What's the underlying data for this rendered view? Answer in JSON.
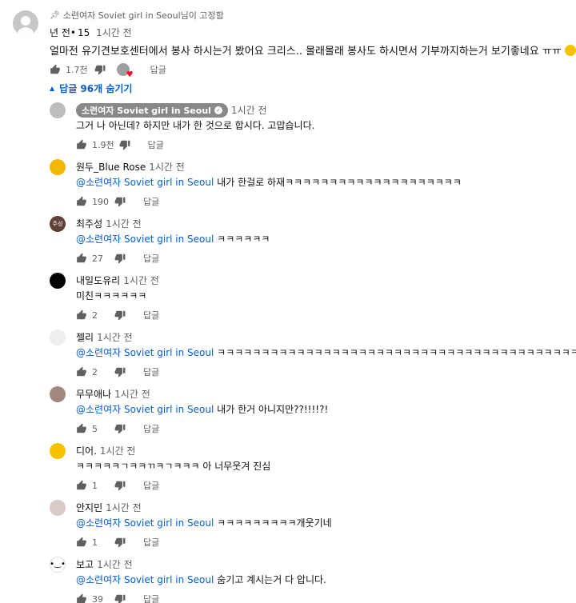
{
  "pinned": {
    "pinned_by": "소련여자 Soviet girl in Seoul님이 고정함",
    "author": "년 전•",
    "author_suffix": "15",
    "time": "1시간 전",
    "text": "얼마전 유기견보호센터에서 봉사 하시는거 봤어요 크리스.. 몰래몰래 봉사도 하시면서 기부까지하는거 보기좋네요 ㅠㅠ",
    "likes": "1.7천",
    "reply_label": "답글"
  },
  "replies_toggle": "답글 96개 숨기기",
  "replies": [
    {
      "author": "소련여자 Soviet girl in Seoul",
      "time": "1시간 전",
      "mention": "",
      "text": "그거 나 아닌데? 하지만 내가 한 것으로 합시다. 고맙습니다.",
      "likes": "1.9천",
      "reply_label": "답글",
      "avatar_color": "#bdbdbd"
    },
    {
      "author": "원두_Blue Rose",
      "time": "1시간 전",
      "mention": "@소련여자 Soviet girl in Seoul",
      "text": "내가 한걸로 하재ㅋㅋㅋㅋㅋㅋㅋㅋㅋㅋㅋㅋㅋㅋㅋㅋㅋㅋㅋㅋ",
      "likes": "190",
      "reply_label": "답글",
      "avatar_color": "#f2b705"
    },
    {
      "author": "최주성",
      "time": "1시간 전",
      "mention": "@소련여자 Soviet girl in Seoul",
      "text": "ㅋㅋㅋㅋㅋㅋ",
      "likes": "27",
      "reply_label": "답글",
      "avatar_color": "#5d4037",
      "avatar_text": "주성"
    },
    {
      "author": "내일도유리",
      "time": "1시간 전",
      "mention": "",
      "text": "미친ㅋㅋㅋㅋㅋㅋ",
      "likes": "2",
      "reply_label": "답글",
      "avatar_color": "#000000"
    },
    {
      "author": "젤리",
      "time": "1시간 전",
      "mention": "@소련여자 Soviet girl in Seoul",
      "text": "ㅋㅋㅋㅋㅋㅋㅋㅋㅋㅋㅋㅋㅋㅋㅋㅋㅋㅋㅋㅋㅋㅋㅋㅋㅋㅋㅋㅋㅋㅋㅋㅋㅋㅋㅋㅋㅋㅋㅋㅋㅋㅋ",
      "likes": "2",
      "reply_label": "답글",
      "avatar_color": "#eeeeee"
    },
    {
      "author": "무무애나",
      "time": "1시간 전",
      "mention": "@소련여자 Soviet girl in Seoul",
      "text": "내가 한거 아니지만??!!!!?!",
      "likes": "5",
      "reply_label": "답글",
      "avatar_color": "#a1887f"
    },
    {
      "author": "디어.",
      "time": "1시간 전",
      "mention": "",
      "text": "ㅋㅋㅋㅋㅋㄱㅋㅋㄲㅋㄱㅋㅋㅋ 아 너무웃겨 진심",
      "likes": "1",
      "reply_label": "답글",
      "avatar_color": "#f7c300"
    },
    {
      "author": "안지민",
      "time": "1시간 전",
      "mention": "@소련여자 Soviet girl in Seoul",
      "text": "ㅋㅋㅋㅋㅋㅋㅋㅋㅋ개웃기네",
      "likes": "1",
      "reply_label": "답글",
      "avatar_color": "#d7ccc8"
    },
    {
      "author": "보고",
      "time": "1시간 전",
      "mention": "@소련여자 Soviet girl in Seoul",
      "text": "숨기고 계시는거 다 압니다.",
      "likes": "39",
      "reply_label": "답글",
      "avatar_color": "#ffffff"
    }
  ],
  "colors": {
    "link": "#065fd4",
    "meta": "#606060",
    "text": "#0f0f0f",
    "heart": "#ff0033"
  }
}
